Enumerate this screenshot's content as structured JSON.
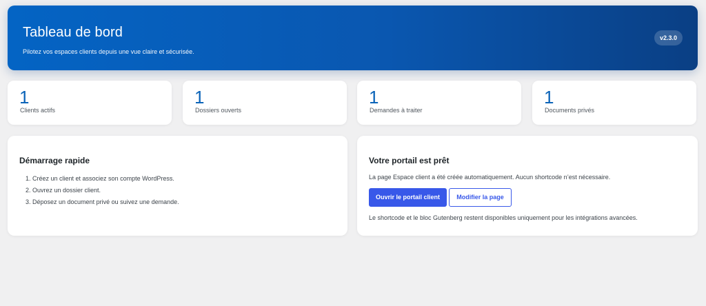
{
  "header": {
    "title": "Tableau de bord",
    "subtitle": "Pilotez vos espaces clients depuis une vue claire et sécurisée.",
    "version": "v2.3.0"
  },
  "stats": [
    {
      "value": "1",
      "label": "Clients actifs"
    },
    {
      "value": "1",
      "label": "Dossiers ouverts"
    },
    {
      "value": "1",
      "label": "Demandes à traiter"
    },
    {
      "value": "1",
      "label": "Documents privés"
    }
  ],
  "quick_start": {
    "title": "Démarrage rapide",
    "steps": [
      "1. Créez un client et associez son compte WordPress.",
      "2. Ouvrez un dossier client.",
      "3. Déposez un document privé ou suivez une demande."
    ]
  },
  "portal": {
    "title": "Votre portail est prêt",
    "description": "La page Espace client a été créée automatiquement. Aucun shortcode n’est nécessaire.",
    "open_button": "Ouvrir le portail client",
    "edit_button": "Modifier la page",
    "note": "Le shortcode et le bloc Gutenberg restent disponibles uniquement pour les intégrations avancées."
  },
  "colors": {
    "accent": "#3858e9",
    "stat_value": "#0b64b8",
    "hero_start": "#0464c4",
    "hero_end": "#0a3f84"
  }
}
